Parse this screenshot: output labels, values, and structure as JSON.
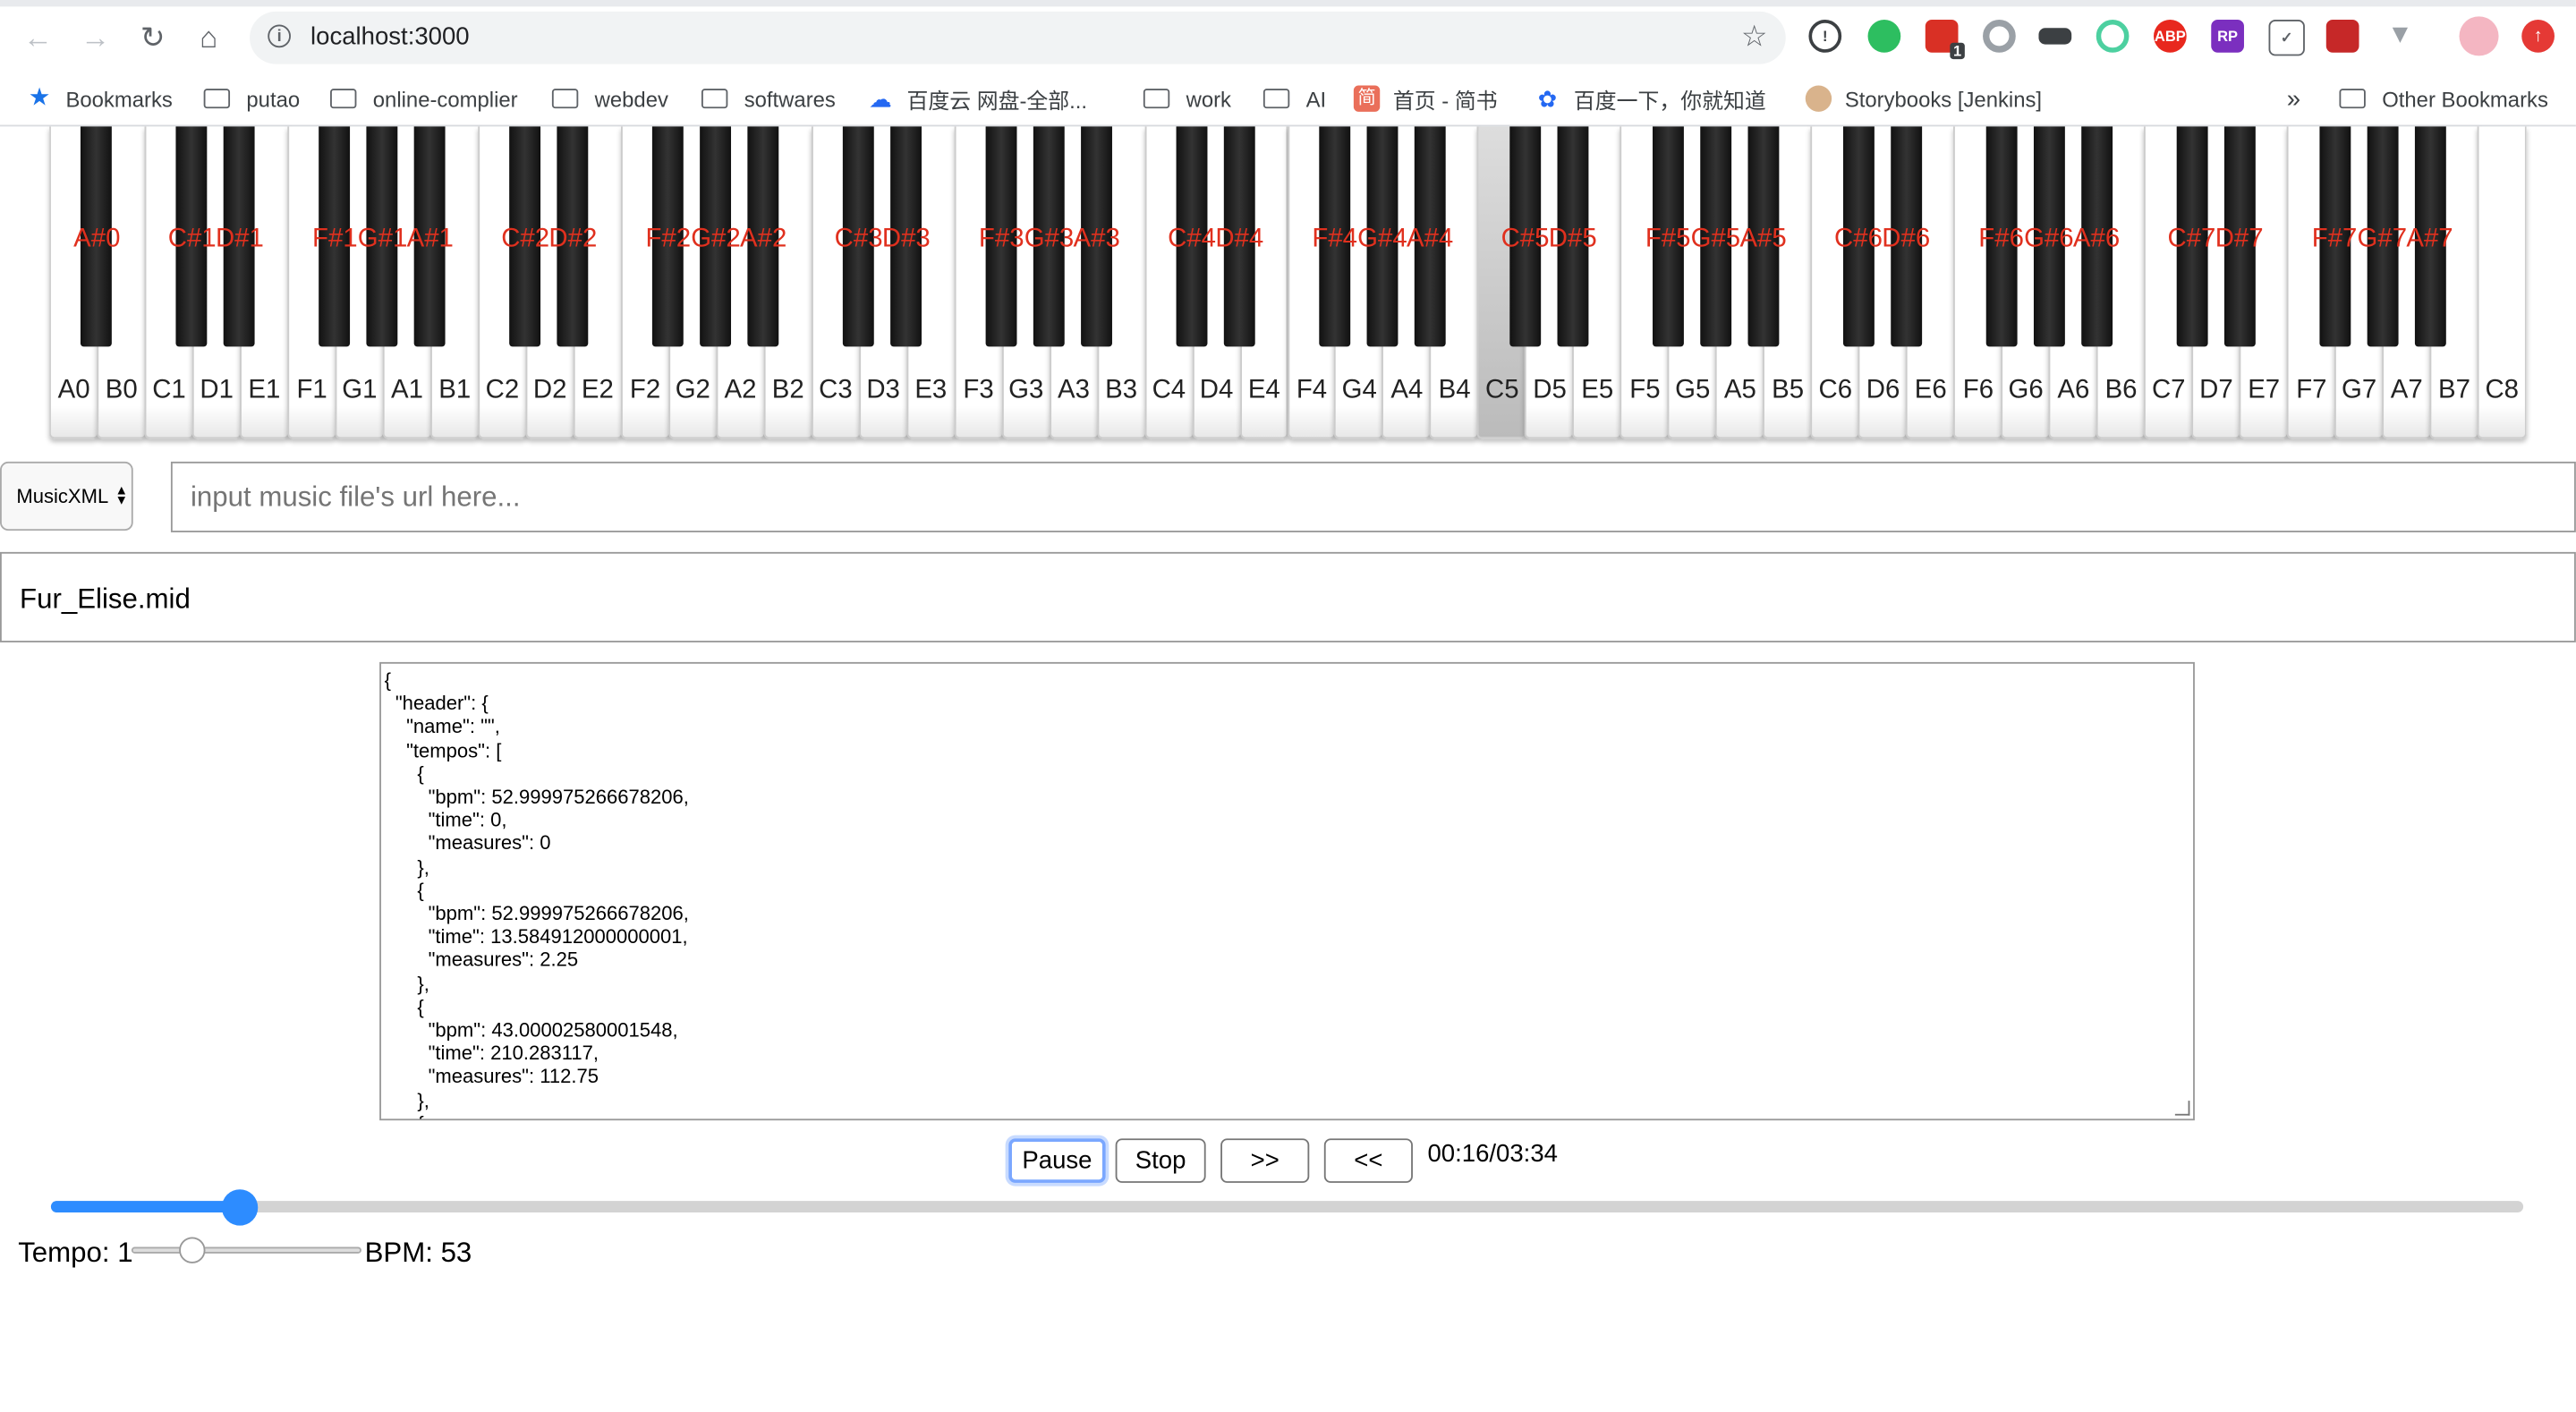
{
  "browser": {
    "url": "localhost:3000",
    "bookmarks": [
      {
        "label": "Bookmarks",
        "icon": "star-icon"
      },
      {
        "label": "putao",
        "icon": "folder-icon"
      },
      {
        "label": "online-complier",
        "icon": "folder-icon"
      },
      {
        "label": "webdev",
        "icon": "folder-icon"
      },
      {
        "label": "softwares",
        "icon": "folder-icon"
      },
      {
        "label": "百度云 网盘-全部...",
        "icon": "baidu-cloud-icon"
      },
      {
        "label": "work",
        "icon": "folder-icon"
      },
      {
        "label": "AI",
        "icon": "folder-icon"
      },
      {
        "label": "首页 - 简书",
        "icon": "jianshu-icon"
      },
      {
        "label": "百度一下，你就知道",
        "icon": "baidu-icon"
      },
      {
        "label": "Storybooks [Jenkins]",
        "icon": "jenkins-icon"
      }
    ],
    "overflow": "»",
    "other_bookmarks": "Other Bookmarks",
    "extension_badge": "1",
    "colors": {
      "accent": "#2d8cff",
      "key_label": "#e0301e"
    }
  },
  "piano": {
    "white_keys": [
      "A0",
      "B0",
      "C1",
      "D1",
      "E1",
      "F1",
      "G1",
      "A1",
      "B1",
      "C2",
      "D2",
      "E2",
      "F2",
      "G2",
      "A2",
      "B2",
      "C3",
      "D3",
      "E3",
      "F3",
      "G3",
      "A3",
      "B3",
      "C4",
      "D4",
      "E4",
      "F4",
      "G4",
      "A4",
      "B4",
      "C5",
      "D5",
      "E5",
      "F5",
      "G5",
      "A5",
      "B5",
      "C6",
      "D6",
      "E6",
      "F6",
      "G6",
      "A6",
      "B6",
      "C7",
      "D7",
      "E7",
      "F7",
      "G7",
      "A7",
      "B7",
      "C8"
    ],
    "black_keys": [
      "A#0",
      "C#1",
      "D#1",
      "F#1",
      "G#1",
      "A#1",
      "C#2",
      "D#2",
      "F#2",
      "G#2",
      "A#2",
      "C#3",
      "D#3",
      "F#3",
      "G#3",
      "A#3",
      "C#4",
      "D#4",
      "F#4",
      "G#4",
      "A#4",
      "C#5",
      "D#5",
      "F#5",
      "G#5",
      "A#5",
      "C#6",
      "D#6",
      "F#6",
      "G#6",
      "A#6",
      "C#7",
      "D#7",
      "F#7",
      "G#7",
      "A#7"
    ],
    "active_key": "C5"
  },
  "controls": {
    "format_select": "MusicXML",
    "url_placeholder": "input music file's url here...",
    "file_name": "Fur_Elise.mid",
    "json_text": "{\n  \"header\": {\n    \"name\": \"\",\n    \"tempos\": [\n      {\n        \"bpm\": 52.999975266678206,\n        \"time\": 0,\n        \"measures\": 0\n      },\n      {\n        \"bpm\": 52.999975266678206,\n        \"time\": 13.584912000000001,\n        \"measures\": 2.25\n      },\n      {\n        \"bpm\": 43.00002580001548,\n        \"time\": 210.283117,\n        \"measures\": 112.75\n      },\n      {",
    "buttons": {
      "pause": "Pause",
      "stop": "Stop",
      "forward": ">>",
      "back": "<<"
    },
    "time_display": "00:16/03:34",
    "progress_fraction": 0.0764,
    "tempo_label": "Tempo: 1",
    "tempo_fraction": 0.26,
    "bpm_label": "BPM: 53"
  }
}
